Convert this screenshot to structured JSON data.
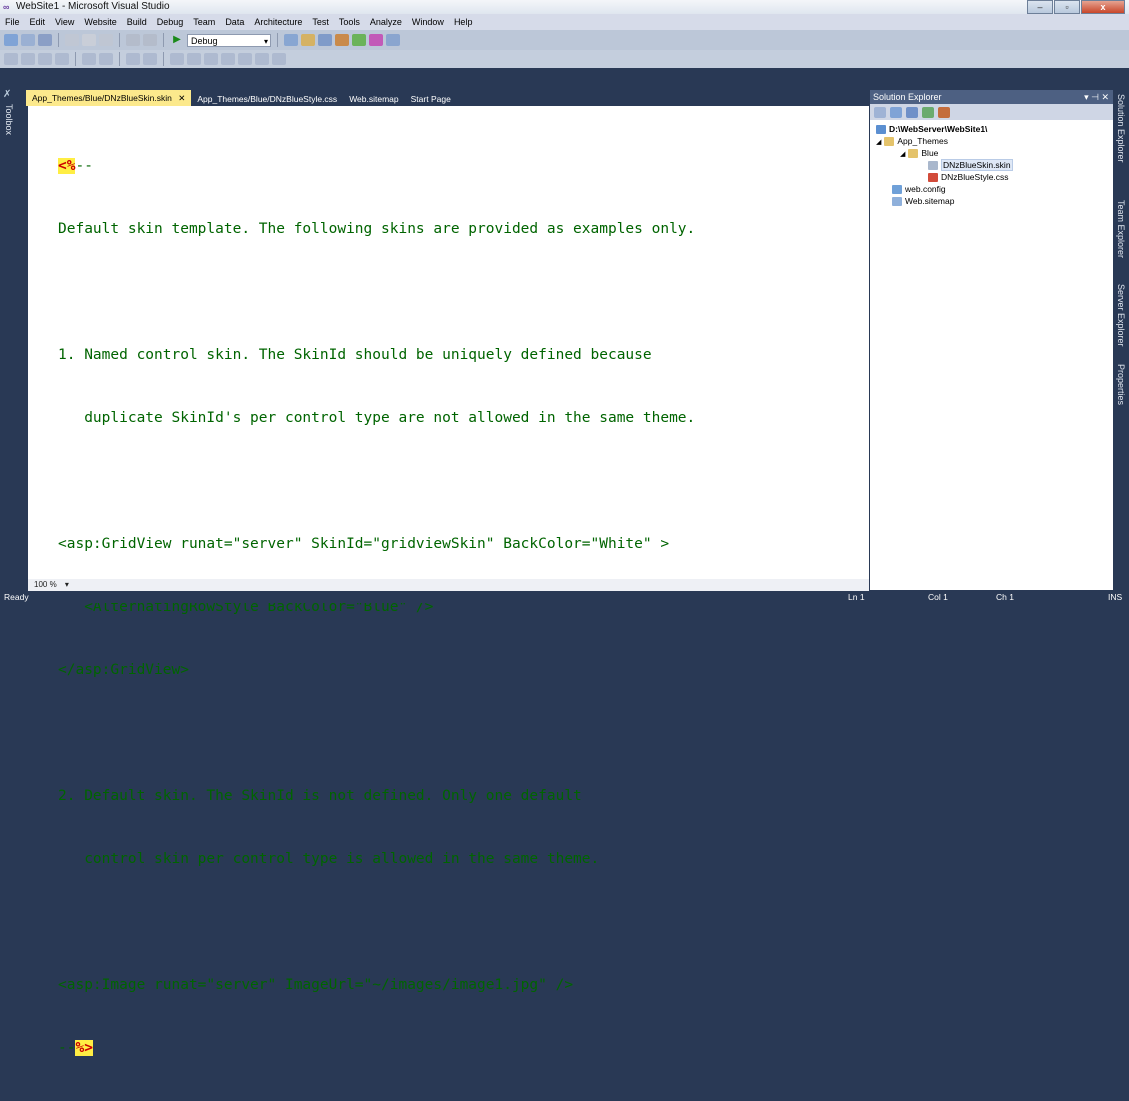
{
  "window": {
    "title": "WebSite1 - Microsoft Visual Studio",
    "minimize": "–",
    "maximize": "▫",
    "close": "x"
  },
  "menu": [
    "File",
    "Edit",
    "View",
    "Website",
    "Build",
    "Debug",
    "Team",
    "Data",
    "Architecture",
    "Test",
    "Tools",
    "Analyze",
    "Window",
    "Help"
  ],
  "toolbar": {
    "config_select": "Debug"
  },
  "toolbox": {
    "label": "Toolbox"
  },
  "tabs": [
    {
      "label": "App_Themes/Blue/DNzBlueSkin.skin",
      "close": "✕"
    },
    {
      "label": "App_Themes/Blue/DNzBlueStyle.css"
    },
    {
      "label": "Web.sitemap"
    },
    {
      "label": "Start Page"
    }
  ],
  "code": {
    "open_marker": "<%",
    "open_tail": "--",
    "line1": "Default skin template. The following skins are provided as examples only.",
    "line2": "1. Named control skin. The SkinId should be uniquely defined because",
    "line3": "   duplicate SkinId's per control type are not allowed in the same theme.",
    "line4": "<asp:GridView runat=\"server\" SkinId=\"gridviewSkin\" BackColor=\"White\" >",
    "line5": "   <AlternatingRowStyle BackColor=\"Blue\" />",
    "line6": "</asp:GridView>",
    "line7": "2. Default skin. The SkinId is not defined. Only one default",
    "line8": "   control skin per control type is allowed in the same theme.",
    "line9": "<asp:Image runat=\"server\" ImageUrl=\"~/images/image1.jpg\" />",
    "close_head": "--",
    "close_marker": "%>"
  },
  "editor_status": {
    "zoom": "100 %"
  },
  "solution_explorer": {
    "title": "Solution Explorer",
    "pin": "▾ ⊣ ✕",
    "items": [
      {
        "label": "D:\\WebServer\\WebSite1\\",
        "icon": "website-icon"
      },
      {
        "label": "App_Themes",
        "icon": "folder-icon"
      },
      {
        "label": "Blue",
        "icon": "folder-icon"
      },
      {
        "label": "DNzBlueSkin.skin",
        "icon": "skin-file-icon"
      },
      {
        "label": "DNzBlueStyle.css",
        "icon": "css-file-icon"
      },
      {
        "label": "web.config",
        "icon": "config-file-icon"
      },
      {
        "label": "Web.sitemap",
        "icon": "sitemap-file-icon"
      }
    ]
  },
  "side_panels": [
    "Solution Explorer",
    "Team Explorer",
    "Server Explorer",
    "Properties"
  ],
  "status": {
    "text": "Ready",
    "ln": "Ln 1",
    "col": "Col 1",
    "ch": "Ch 1",
    "mode": "INS"
  },
  "colors": {
    "accent": "#293955",
    "tab_active": "#fce98c",
    "code_green": "#006400"
  }
}
